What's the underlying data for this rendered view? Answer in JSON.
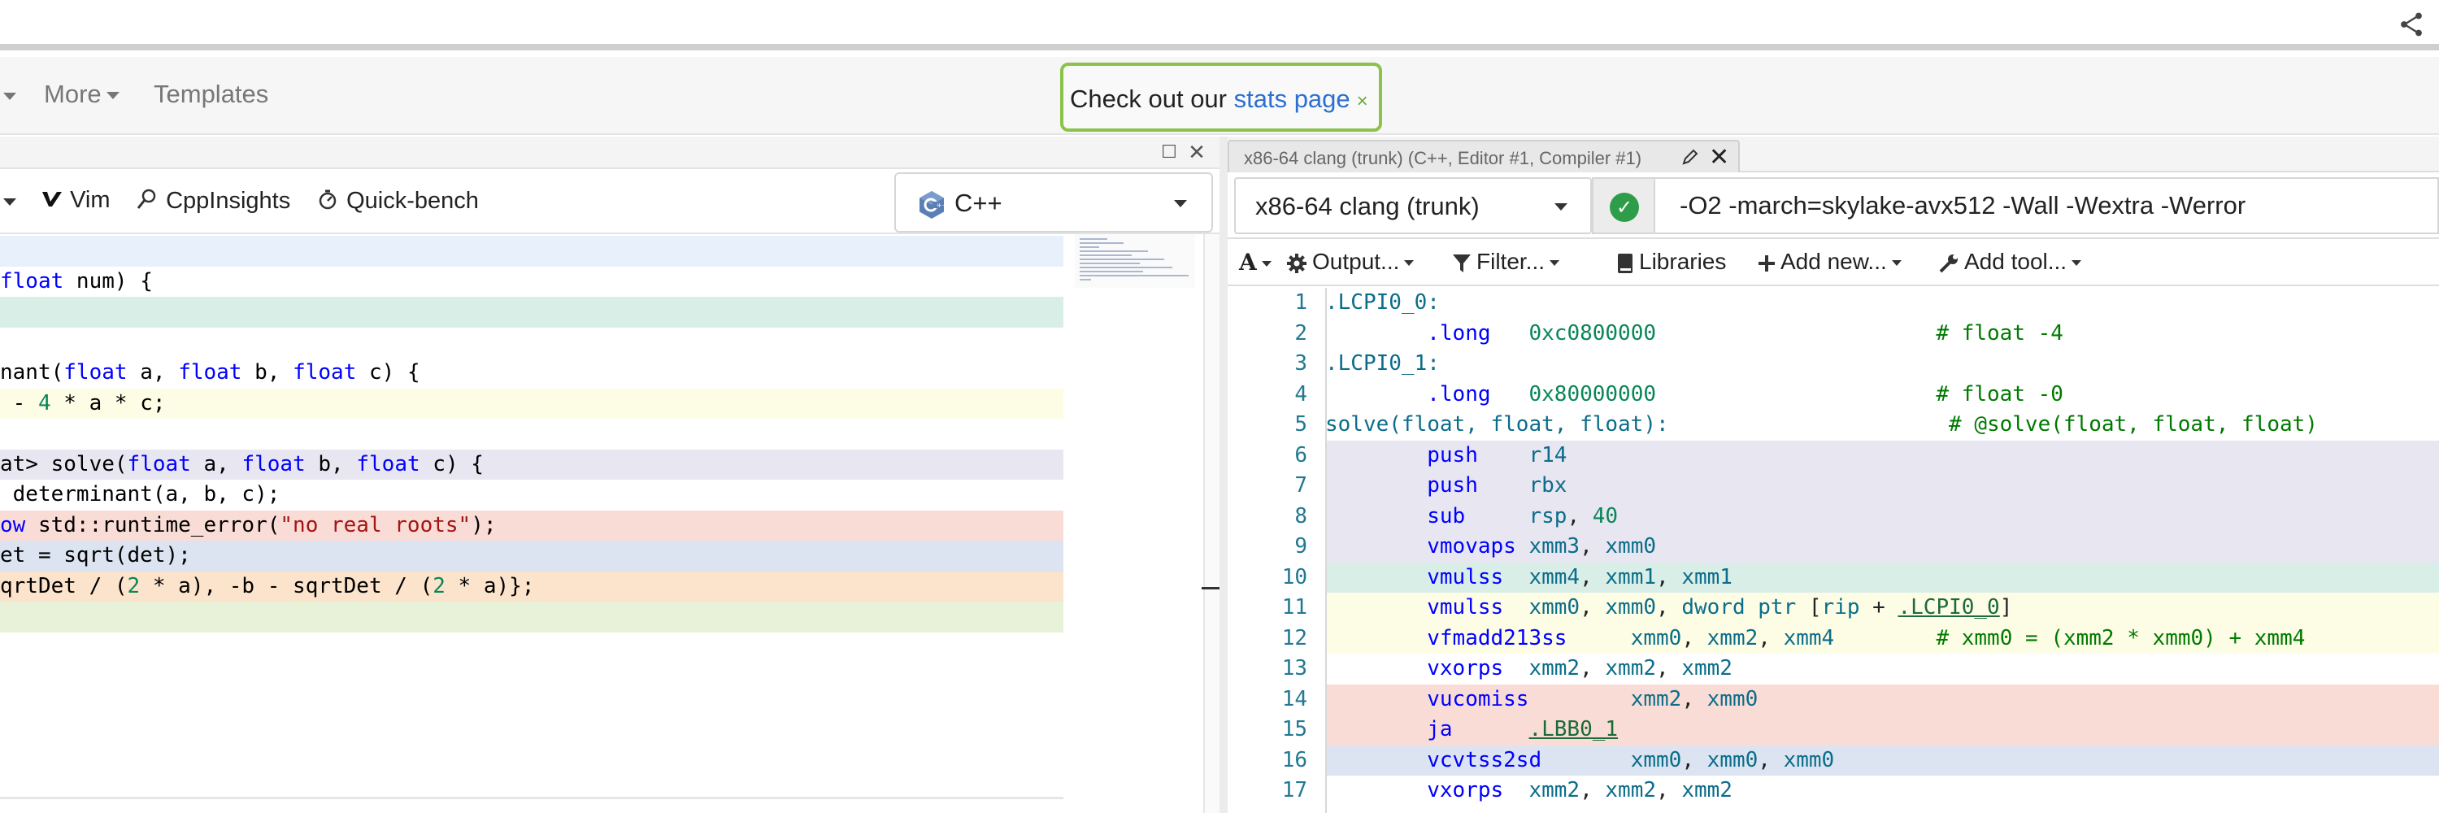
{
  "navbar": {
    "more_label": "More",
    "templates_label": "Templates"
  },
  "banner": {
    "prefix": "Check out our ",
    "link": "stats page",
    "close": "×"
  },
  "left_pane": {
    "toolbar": {
      "vim_label": "Vim",
      "cppinsights_label": "CppInsights",
      "quickbench_label": "Quick-bench"
    },
    "language": "C++",
    "code_lines": [
      {
        "bg": "#e8f1fb",
        "segments": []
      },
      {
        "bg": "#ffffff",
        "segments": [
          {
            "t": "float",
            "c": "kw"
          },
          {
            "t": " num) {",
            "c": ""
          }
        ]
      },
      {
        "bg": "#daeee8",
        "segments": []
      },
      {
        "bg": "#ffffff",
        "segments": []
      },
      {
        "bg": "#ffffff",
        "segments": [
          {
            "t": "nant(",
            "c": ""
          },
          {
            "t": "float",
            "c": "kw"
          },
          {
            "t": " a, ",
            "c": ""
          },
          {
            "t": "float",
            "c": "kw"
          },
          {
            "t": " b, ",
            "c": ""
          },
          {
            "t": "float",
            "c": "kw"
          },
          {
            "t": " c) {",
            "c": ""
          }
        ]
      },
      {
        "bg": "#fdfde6",
        "segments": [
          {
            "t": " - ",
            "c": ""
          },
          {
            "t": "4",
            "c": "num"
          },
          {
            "t": " * a * c;",
            "c": ""
          }
        ]
      },
      {
        "bg": "#ffffff",
        "segments": []
      },
      {
        "bg": "#e7e6f1",
        "segments": [
          {
            "t": "at> solve(",
            "c": ""
          },
          {
            "t": "float",
            "c": "kw"
          },
          {
            "t": " a, ",
            "c": ""
          },
          {
            "t": "float",
            "c": "kw"
          },
          {
            "t": " b, ",
            "c": ""
          },
          {
            "t": "float",
            "c": "kw"
          },
          {
            "t": " c) {",
            "c": ""
          }
        ]
      },
      {
        "bg": "#ffffff",
        "segments": [
          {
            "t": " determinant(a, b, c);",
            "c": ""
          }
        ]
      },
      {
        "bg": "#fadcd6",
        "segments": [
          {
            "t": "ow",
            "c": "kw"
          },
          {
            "t": " std::runtime_error(",
            "c": ""
          },
          {
            "t": "\"no real roots\"",
            "c": "str"
          },
          {
            "t": ");",
            "c": ""
          }
        ]
      },
      {
        "bg": "#dbe4f0",
        "segments": [
          {
            "t": "et = sqrt(det);",
            "c": ""
          }
        ]
      },
      {
        "bg": "#fbe3cc",
        "segments": [
          {
            "t": "qrtDet / (",
            "c": ""
          },
          {
            "t": "2",
            "c": "num"
          },
          {
            "t": " * a), -b - sqrtDet / (",
            "c": ""
          },
          {
            "t": "2",
            "c": "num"
          },
          {
            "t": " * a)};",
            "c": ""
          }
        ]
      },
      {
        "bg": "#e8f2d8",
        "segments": []
      }
    ]
  },
  "right_pane": {
    "tab_title": "x86-64 clang (trunk) (C++, Editor #1, Compiler #1)",
    "compiler": "x86-64 clang (trunk)",
    "flags": "-O2 -march=skylake-avx512 -Wall -Wextra -Werror",
    "toolbar": {
      "font_label": "A",
      "output_label": "Output...",
      "filter_label": "Filter...",
      "libraries_label": "Libraries",
      "add_new_label": "Add new...",
      "add_tool_label": "Add tool..."
    },
    "asm_lines": [
      {
        "n": "1",
        "bg": "#ffffff",
        "segments": [
          {
            "t": ".LCPI0_0:",
            "c": "lbl-c"
          }
        ]
      },
      {
        "n": "2",
        "bg": "#ffffff",
        "segments": [
          {
            "t": "        ",
            "c": ""
          },
          {
            "t": ".long",
            "c": "ins-c"
          },
          {
            "t": "   ",
            "c": ""
          },
          {
            "t": "0xc0800000",
            "c": "imm-c"
          },
          {
            "t": "                      ",
            "c": ""
          },
          {
            "t": "# float -4",
            "c": "cmt-c"
          }
        ]
      },
      {
        "n": "3",
        "bg": "#ffffff",
        "segments": [
          {
            "t": ".LCPI0_1:",
            "c": "lbl-c"
          }
        ]
      },
      {
        "n": "4",
        "bg": "#ffffff",
        "segments": [
          {
            "t": "        ",
            "c": ""
          },
          {
            "t": ".long",
            "c": "ins-c"
          },
          {
            "t": "   ",
            "c": ""
          },
          {
            "t": "0x80000000",
            "c": "imm-c"
          },
          {
            "t": "                      ",
            "c": ""
          },
          {
            "t": "# float -0",
            "c": "cmt-c"
          }
        ]
      },
      {
        "n": "5",
        "bg": "#ffffff",
        "segments": [
          {
            "t": "solve(float, float, float):",
            "c": "lbl-c"
          },
          {
            "t": "                      ",
            "c": ""
          },
          {
            "t": "# @solve(float, float, float)",
            "c": "cmt-c"
          }
        ]
      },
      {
        "n": "6",
        "bg": "#e7e6f1",
        "segments": [
          {
            "t": "        ",
            "c": ""
          },
          {
            "t": "push",
            "c": "ins-c"
          },
          {
            "t": "    ",
            "c": ""
          },
          {
            "t": "r14",
            "c": "reg-c"
          }
        ]
      },
      {
        "n": "7",
        "bg": "#e7e6f1",
        "segments": [
          {
            "t": "        ",
            "c": ""
          },
          {
            "t": "push",
            "c": "ins-c"
          },
          {
            "t": "    ",
            "c": ""
          },
          {
            "t": "rbx",
            "c": "reg-c"
          }
        ]
      },
      {
        "n": "8",
        "bg": "#e7e6f1",
        "segments": [
          {
            "t": "        ",
            "c": ""
          },
          {
            "t": "sub",
            "c": "ins-c"
          },
          {
            "t": "     ",
            "c": ""
          },
          {
            "t": "rsp",
            "c": "reg-c"
          },
          {
            "t": ", ",
            "c": "sym-c"
          },
          {
            "t": "40",
            "c": "imm-c"
          }
        ]
      },
      {
        "n": "9",
        "bg": "#e7e6f1",
        "segments": [
          {
            "t": "        ",
            "c": ""
          },
          {
            "t": "vmovaps",
            "c": "ins-c"
          },
          {
            "t": " ",
            "c": ""
          },
          {
            "t": "xmm3",
            "c": "reg-c"
          },
          {
            "t": ", ",
            "c": "sym-c"
          },
          {
            "t": "xmm0",
            "c": "reg-c"
          }
        ]
      },
      {
        "n": "10",
        "bg": "#daeee8",
        "segments": [
          {
            "t": "        ",
            "c": ""
          },
          {
            "t": "vmulss",
            "c": "ins-c"
          },
          {
            "t": "  ",
            "c": ""
          },
          {
            "t": "xmm4",
            "c": "reg-c"
          },
          {
            "t": ", ",
            "c": "sym-c"
          },
          {
            "t": "xmm1",
            "c": "reg-c"
          },
          {
            "t": ", ",
            "c": "sym-c"
          },
          {
            "t": "xmm1",
            "c": "reg-c"
          }
        ]
      },
      {
        "n": "11",
        "bg": "#fdfde6",
        "segments": [
          {
            "t": "        ",
            "c": ""
          },
          {
            "t": "vmulss",
            "c": "ins-c"
          },
          {
            "t": "  ",
            "c": ""
          },
          {
            "t": "xmm0",
            "c": "reg-c"
          },
          {
            "t": ", ",
            "c": "sym-c"
          },
          {
            "t": "xmm0",
            "c": "reg-c"
          },
          {
            "t": ", ",
            "c": "sym-c"
          },
          {
            "t": "dword ptr",
            "c": "reg-c"
          },
          {
            "t": " [",
            "c": "sym-c"
          },
          {
            "t": "rip",
            "c": "reg-c"
          },
          {
            "t": " + ",
            "c": "sym-c"
          },
          {
            "t": ".LCPI0_0",
            "c": "lnk-c"
          },
          {
            "t": "]",
            "c": "sym-c"
          }
        ]
      },
      {
        "n": "12",
        "bg": "#fdfde6",
        "segments": [
          {
            "t": "        ",
            "c": ""
          },
          {
            "t": "vfmadd213ss",
            "c": "ins-c"
          },
          {
            "t": "     ",
            "c": ""
          },
          {
            "t": "xmm0",
            "c": "reg-c"
          },
          {
            "t": ", ",
            "c": "sym-c"
          },
          {
            "t": "xmm2",
            "c": "reg-c"
          },
          {
            "t": ", ",
            "c": "sym-c"
          },
          {
            "t": "xmm4",
            "c": "reg-c"
          },
          {
            "t": "        ",
            "c": ""
          },
          {
            "t": "# xmm0 = (xmm2 * xmm0) + xmm4",
            "c": "cmt-c"
          }
        ]
      },
      {
        "n": "13",
        "bg": "#ffffff",
        "segments": [
          {
            "t": "        ",
            "c": ""
          },
          {
            "t": "vxorps",
            "c": "ins-c"
          },
          {
            "t": "  ",
            "c": ""
          },
          {
            "t": "xmm2",
            "c": "reg-c"
          },
          {
            "t": ", ",
            "c": "sym-c"
          },
          {
            "t": "xmm2",
            "c": "reg-c"
          },
          {
            "t": ", ",
            "c": "sym-c"
          },
          {
            "t": "xmm2",
            "c": "reg-c"
          }
        ]
      },
      {
        "n": "14",
        "bg": "#fadcd6",
        "segments": [
          {
            "t": "        ",
            "c": ""
          },
          {
            "t": "vucomiss",
            "c": "ins-c"
          },
          {
            "t": "        ",
            "c": ""
          },
          {
            "t": "xmm2",
            "c": "reg-c"
          },
          {
            "t": ", ",
            "c": "sym-c"
          },
          {
            "t": "xmm0",
            "c": "reg-c"
          }
        ]
      },
      {
        "n": "15",
        "bg": "#fadcd6",
        "segments": [
          {
            "t": "        ",
            "c": ""
          },
          {
            "t": "ja",
            "c": "ins-c"
          },
          {
            "t": "      ",
            "c": ""
          },
          {
            "t": ".LBB0_1",
            "c": "lnk-c"
          }
        ]
      },
      {
        "n": "16",
        "bg": "#dbe4f0",
        "segments": [
          {
            "t": "        ",
            "c": ""
          },
          {
            "t": "vcvtss2sd",
            "c": "ins-c"
          },
          {
            "t": "       ",
            "c": ""
          },
          {
            "t": "xmm0",
            "c": "reg-c"
          },
          {
            "t": ", ",
            "c": "sym-c"
          },
          {
            "t": "xmm0",
            "c": "reg-c"
          },
          {
            "t": ", ",
            "c": "sym-c"
          },
          {
            "t": "xmm0",
            "c": "reg-c"
          }
        ]
      },
      {
        "n": "17",
        "bg": "#ffffff",
        "segments": [
          {
            "t": "        ",
            "c": ""
          },
          {
            "t": "vxorps",
            "c": "ins-c"
          },
          {
            "t": "  ",
            "c": ""
          },
          {
            "t": "xmm2",
            "c": "reg-c"
          },
          {
            "t": ", ",
            "c": "sym-c"
          },
          {
            "t": "xmm2",
            "c": "reg-c"
          },
          {
            "t": ", ",
            "c": "sym-c"
          },
          {
            "t": "xmm2",
            "c": "reg-c"
          }
        ]
      }
    ]
  }
}
